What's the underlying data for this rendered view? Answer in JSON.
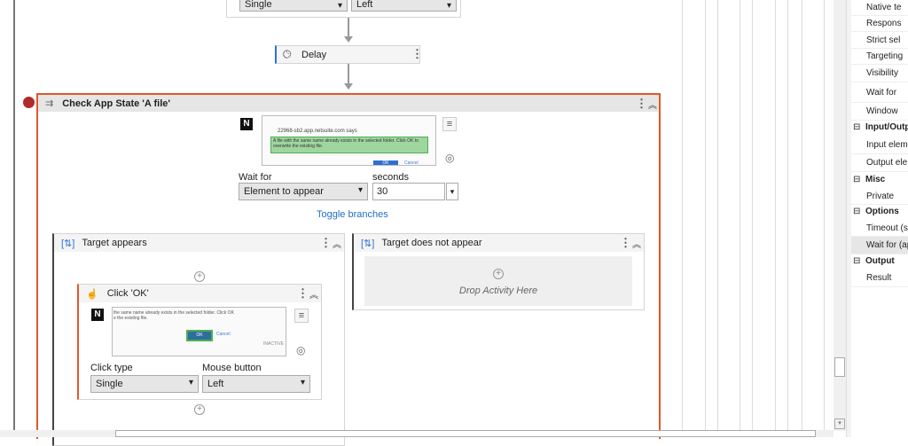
{
  "top_activity": {
    "click_type": "Single",
    "mouse_button": "Left"
  },
  "delay": {
    "title": "Delay"
  },
  "check_app_state": {
    "title": "Check App State 'A file'",
    "screenshot": {
      "site": "22968-sb2.app.netsuite.com says",
      "message": "A file with the same name already exists in the selected folder. Click OK to overwrite the existing file.",
      "ok": "OK",
      "cancel": "Cancel"
    },
    "wait_for_label": "Wait for",
    "wait_for_value": "Element to appear",
    "seconds_label": "seconds",
    "seconds_value": "30",
    "toggle_branches": "Toggle branches"
  },
  "target_appears": {
    "title": "Target appears",
    "click": {
      "title": "Click 'OK'",
      "screenshot": {
        "message": "the same name already exists in the selected folder. Click OK e the existing file.",
        "ok": "OK",
        "cancel": "Cancel",
        "inactive": "INACTIVE"
      },
      "click_type_label": "Click type",
      "click_type": "Single",
      "mouse_button_label": "Mouse button",
      "mouse_button": "Left"
    }
  },
  "target_not_appear": {
    "title": "Target does not appear",
    "drop": "Drop Activity Here"
  },
  "properties": {
    "rows_top": [
      "Native te",
      "Respons",
      "Strict sel",
      "Targeting",
      "Visibility",
      "Wait for",
      "Window"
    ],
    "cat_io": "Input/Outp",
    "rows_io": [
      "Input elem",
      "Output ele"
    ],
    "cat_misc": "Misc",
    "rows_misc": [
      "Private"
    ],
    "cat_options": "Options",
    "rows_options": [
      "Timeout (s",
      "Wait for (ap"
    ],
    "cat_output": "Output",
    "rows_output": [
      "Result"
    ]
  },
  "colors": {
    "accent": "#e0582a",
    "breakpoint": "#b22a2a",
    "link": "#1f6fc5"
  }
}
